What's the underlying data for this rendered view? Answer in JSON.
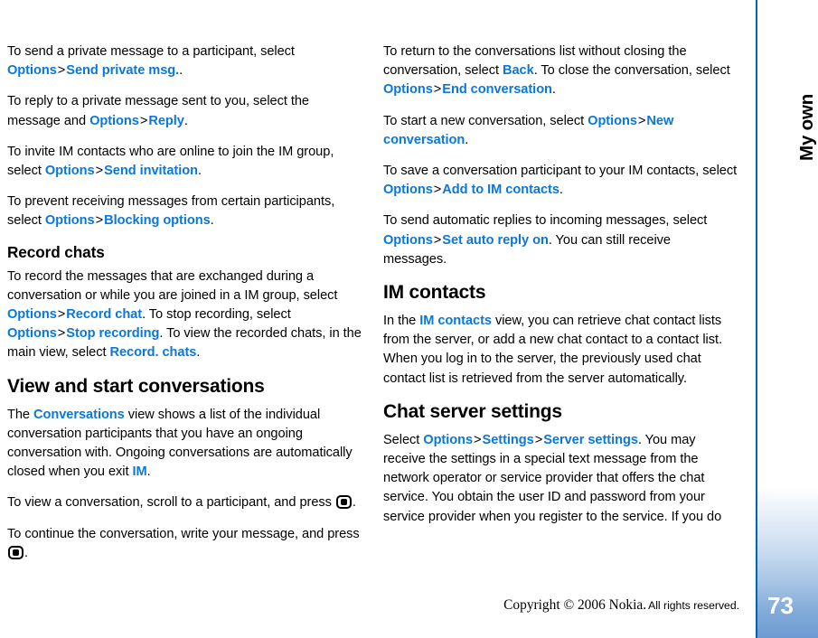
{
  "sidebar": {
    "chapter_label": "My own",
    "page_number": "73",
    "rule_color": "#0066b3",
    "gradient_color": "#6d9bd1"
  },
  "footer": {
    "copyright_main": "Copyright © 2006 Nokia.",
    "copyright_rights": "All rights reserved."
  },
  "theme": {
    "link_color": "#0b77d8",
    "text_color": "#000000",
    "background": "#ffffff"
  },
  "left_column": {
    "p1": {
      "t1": "To send a private message to a participant, select ",
      "l1": "Options",
      "sep1": ">",
      "l2": "Send private msg.",
      "t2": "."
    },
    "p2": {
      "t1": "To reply to a private message sent to you, select the message and ",
      "l1": "Options",
      "sep1": ">",
      "l2": "Reply",
      "t2": "."
    },
    "p3": {
      "t1": "To invite IM contacts who are online to join the IM group, select ",
      "l1": "Options",
      "sep1": ">",
      "l2": "Send invitation",
      "t2": "."
    },
    "p4": {
      "t1": "To prevent receiving messages from certain participants, select ",
      "l1": "Options",
      "sep1": ">",
      "l2": "Blocking options",
      "t2": "."
    },
    "h_record_chats": "Record chats",
    "p5": {
      "t1": "To record the messages that are exchanged during a conversation or while you are joined in a IM group, select ",
      "l1": "Options",
      "sep1": ">",
      "l2": "Record chat",
      "t2": ". To stop recording, select ",
      "l3": "Options",
      "sep2": ">",
      "l4": "Stop recording",
      "t3": ". To view the recorded chats, in the main view, select ",
      "l5": "Record. chats",
      "t4": "."
    },
    "h_view_start": "View and start conversations",
    "p6": {
      "t1": "The ",
      "l1": "Conversations",
      "t2": " view shows a list of the individual conversation participants that you have an ongoing conversation with. Ongoing conversations are automatically closed when you exit ",
      "l2": "IM",
      "t3": "."
    },
    "p7": {
      "t1": "To view a conversation, scroll to a participant, and press ",
      "icon": "scroll-key-icon",
      "t2": "."
    },
    "p8": {
      "t1": "To continue the conversation, write your message, and press ",
      "icon": "scroll-key-icon",
      "t2": "."
    }
  },
  "right_column": {
    "p1": {
      "t1": "To return to the conversations list without closing the conversation, select ",
      "l1": "Back",
      "t2": ". To close the conversation, select ",
      "l2": "Options",
      "sep1": ">",
      "l3": "End conversation",
      "t3": "."
    },
    "p2": {
      "t1": "To start a new conversation, select ",
      "l1": "Options",
      "sep1": ">",
      "l2": "New conversation",
      "t2": "."
    },
    "p3": {
      "t1": "To save a conversation participant to your IM contacts, select ",
      "l1": "Options",
      "sep1": ">",
      "l2": "Add to IM contacts",
      "t2": "."
    },
    "p4": {
      "t1": "To send automatic replies to incoming messages, select ",
      "l1": "Options",
      "sep1": ">",
      "l2": "Set auto reply on",
      "t2": ". You can still receive messages."
    },
    "h_im_contacts": "IM contacts",
    "p5": {
      "t1": "In the ",
      "l1": "IM contacts",
      "t2": " view, you can retrieve chat contact lists from the server, or add a new chat contact to a contact list. When you log in to the server, the previously used chat contact list is retrieved from the server automatically."
    },
    "h_chat_server": "Chat server settings",
    "p6": {
      "t1": "Select ",
      "l1": "Options",
      "sep1": ">",
      "l2": "Settings",
      "sep2": ">",
      "l3": "Server settings",
      "t2": ". You may receive the settings in a special text message from the network operator or service provider that offers the chat service. You obtain the user ID and password from your service provider when you register to the service. If you do"
    }
  }
}
